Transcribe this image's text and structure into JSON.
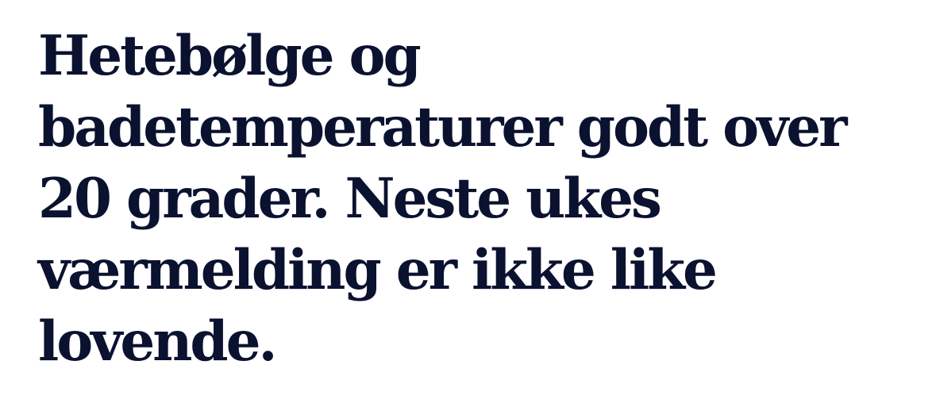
{
  "article": {
    "headline_lines": [
      "Hetebølge og",
      "badetemperaturer godt over",
      "20 grader. Neste ukes",
      "værmelding er ikke like",
      "lovende."
    ]
  },
  "colors": {
    "headline_text": "#0b1230",
    "background": "#ffffff"
  }
}
